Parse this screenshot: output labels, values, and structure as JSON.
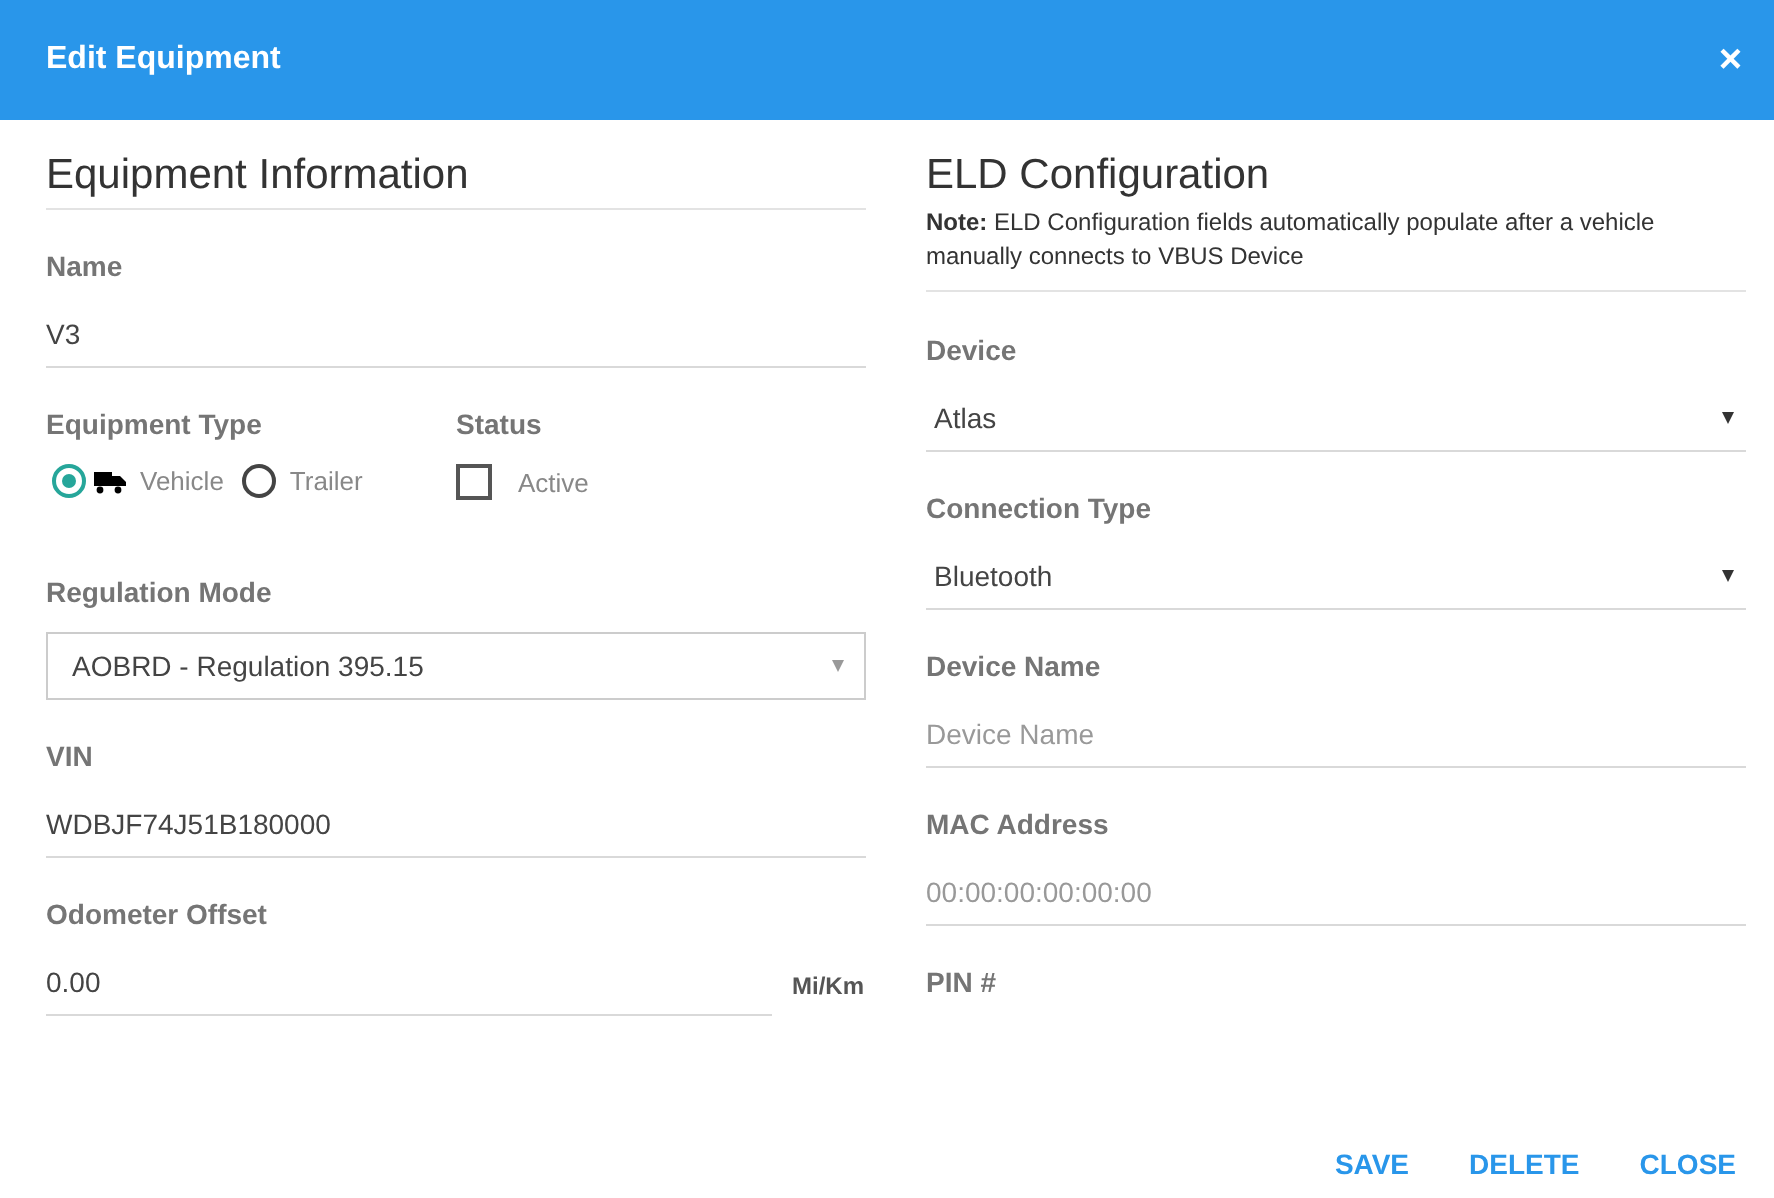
{
  "dialog": {
    "title": "Edit Equipment",
    "close_label": "×"
  },
  "equipment_information": {
    "heading": "Equipment Information",
    "name": {
      "label": "Name",
      "value": "V3"
    },
    "equipment_type": {
      "label": "Equipment Type",
      "options": [
        {
          "label": "Vehicle",
          "selected": true,
          "kind": "vehicle"
        },
        {
          "label": "Trailer",
          "selected": false
        }
      ]
    },
    "status": {
      "label": "Status",
      "checkbox": {
        "label": "Active",
        "checked": false
      }
    },
    "regulation_mode": {
      "label": "Regulation Mode",
      "value": "AOBRD - Regulation 395.15"
    },
    "vin": {
      "label": "VIN",
      "value": "WDBJF74J51B180000"
    },
    "odometer_offset": {
      "label": "Odometer Offset",
      "value": "0.00",
      "unit": "Mi/Km"
    }
  },
  "eld_configuration": {
    "heading": "ELD Configuration",
    "note": "**Note:** ELD Configuration fields automatically populate after a vehicle manually connects to VBUS Device",
    "fields": [
      {
        "kind": "select",
        "label": "Device",
        "value": "Atlas"
      },
      {
        "kind": "select",
        "label": "Connection Type",
        "value": "Bluetooth"
      },
      {
        "kind": "input",
        "label": "Device Name",
        "placeholder": "Device Name"
      },
      {
        "kind": "input",
        "label": "MAC Address",
        "placeholder": "00:00:00:00:00:00"
      },
      {
        "kind": "cut",
        "label": "PIN #"
      }
    ]
  },
  "buttons": [
    "SAVE",
    "DELETE",
    "CLOSE"
  ]
}
